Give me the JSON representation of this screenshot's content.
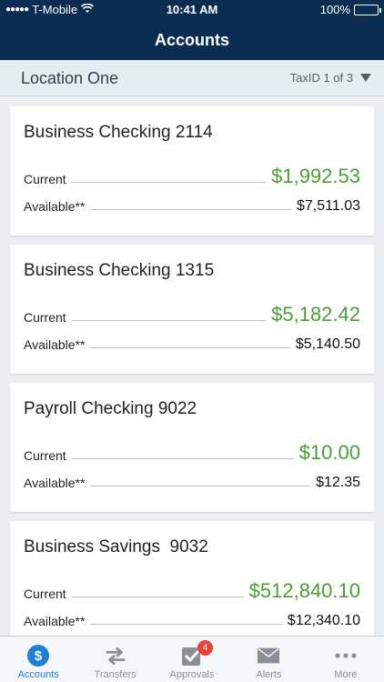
{
  "status_bar": {
    "carrier": "T-Mobile",
    "time": "10:41 AM",
    "battery": "100%"
  },
  "header": {
    "title": "Accounts"
  },
  "location": {
    "name": "Location One",
    "taxid": "TaxID 1 of 3"
  },
  "accounts": [
    {
      "name": "Business Checking 2114",
      "current_label": "Current",
      "current": "$1,992.53",
      "available_label": "Available**",
      "available": "$7,511.03"
    },
    {
      "name": "Business Checking 1315",
      "current_label": "Current",
      "current": "$5,182.42",
      "available_label": "Available**",
      "available": "$5,140.50"
    },
    {
      "name": "Payroll Checking 9022",
      "current_label": "Current",
      "current": "$10.00",
      "available_label": "Available**",
      "available": "$12.35"
    },
    {
      "name": "Business Savings  9032",
      "current_label": "Current",
      "current": "$512,840.10",
      "available_label": "Available**",
      "available": "$12,340.10"
    }
  ],
  "tabs": [
    {
      "label": "Accounts",
      "icon": "dollar-icon",
      "active": true
    },
    {
      "label": "Transfers",
      "icon": "transfer-arrows-icon"
    },
    {
      "label": "Approvals",
      "icon": "checkbox-icon",
      "badge": "4"
    },
    {
      "label": "Alerts",
      "icon": "envelope-icon"
    },
    {
      "label": "More",
      "icon": "more-dots-icon"
    }
  ],
  "colors": {
    "header_bg": "#0c2d52",
    "current_amount": "#4a9f32",
    "active_tab": "#1e7fd6",
    "badge": "#e8423b"
  }
}
